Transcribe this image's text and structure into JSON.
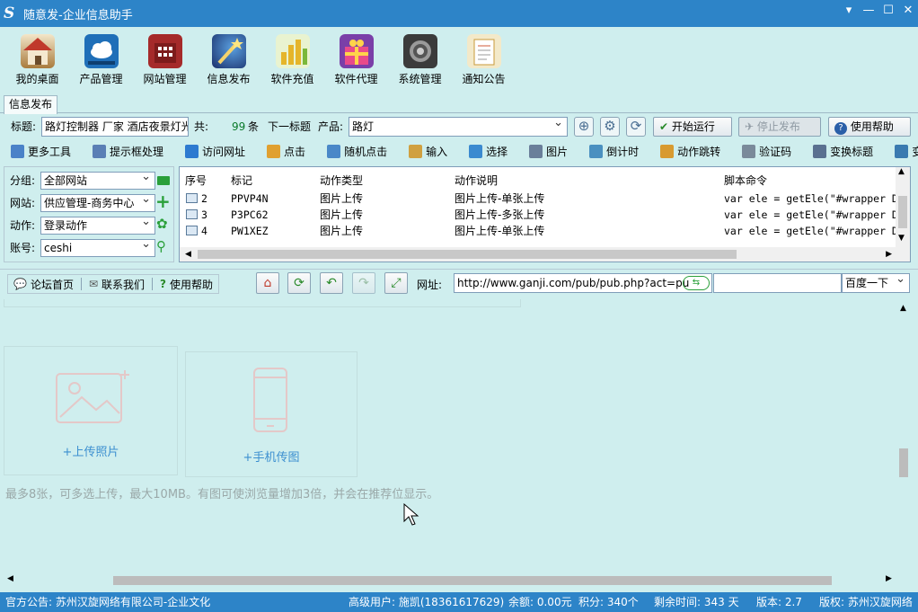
{
  "window": {
    "title": "随意发-企业信息助手",
    "logo_letter": "S"
  },
  "main_toolbar": [
    {
      "label": "我的桌面",
      "icon": "home-icon"
    },
    {
      "label": "产品管理",
      "icon": "cloud-icon"
    },
    {
      "label": "网站管理",
      "icon": "building-icon"
    },
    {
      "label": "信息发布",
      "icon": "wand-icon"
    },
    {
      "label": "软件充值",
      "icon": "coins-icon"
    },
    {
      "label": "软件代理",
      "icon": "gift-icon"
    },
    {
      "label": "系统管理",
      "icon": "gear-icon"
    },
    {
      "label": "通知公告",
      "icon": "notepad-icon"
    }
  ],
  "tab": {
    "label": "信息发布"
  },
  "form": {
    "title_label": "标题:",
    "title_value": "路灯控制器 厂家 酒店夜景灯光",
    "total_label": "共:",
    "total_count": "99",
    "total_unit": "条",
    "next_title_label": "下一标题",
    "product_label": "产品:",
    "product_value": "路灯",
    "start_button": "开始运行",
    "stop_button": "停止发布",
    "help_button": "使用帮助"
  },
  "toolbar2": [
    {
      "label": "更多工具",
      "color": "#4a82c8"
    },
    {
      "label": "提示框处理",
      "color": "#5a7fb5"
    },
    {
      "label": "访问网址",
      "color": "#2d7ad0"
    },
    {
      "label": "点击",
      "color": "#e0a030"
    },
    {
      "label": "随机点击",
      "color": "#4a88c8"
    },
    {
      "label": "输入",
      "color": "#d0a040"
    },
    {
      "label": "选择",
      "color": "#3a8ad0"
    },
    {
      "label": "图片",
      "color": "#6a7f9a"
    },
    {
      "label": "倒计时",
      "color": "#4a90c0"
    },
    {
      "label": "动作跳转",
      "color": "#d89a30"
    },
    {
      "label": "验证码",
      "color": "#7a8a9a"
    },
    {
      "label": "变换标题",
      "color": "#5a7090"
    },
    {
      "label": "变换产品",
      "color": "#3a7ab0"
    }
  ],
  "left_panel": {
    "group_label": "分组:",
    "group_value": "全部网站",
    "site_label": "网站:",
    "site_value": "供应管理-商务中心",
    "action_label": "动作:",
    "action_value": "登录动作",
    "account_label": "账号:",
    "account_value": "ceshi"
  },
  "table": {
    "columns": [
      "序号",
      "标记",
      "动作类型",
      "动作说明",
      "脚本命令"
    ],
    "rows": [
      {
        "no": "2",
        "tag": "PPVP4N",
        "type": "图片上传",
        "desc": "图片上传-单张上传",
        "script": "var ele = getEle(\"#wrapper DIV F"
      },
      {
        "no": "3",
        "tag": "P3PC62",
        "type": "图片上传",
        "desc": "图片上传-多张上传",
        "script": "var ele = getEle(\"#wrapper DIV F"
      },
      {
        "no": "4",
        "tag": "PW1XEZ",
        "type": "图片上传",
        "desc": "图片上传-单张上传",
        "script": "var ele = getEle(\"#wrapper DIV F"
      }
    ]
  },
  "browser_bar": {
    "forum_home": "论坛首页",
    "contact_us": "联系我们",
    "help": "使用帮助",
    "url_label": "网址:",
    "url_value": "http://www.ganji.com/pub/pub.php?act=pu",
    "search_value": "",
    "search_engine": "百度一下"
  },
  "web": {
    "upload_photo": "+上传照片",
    "phone_upload": "+手机传图",
    "hint": "最多8张，可多选上传，最大10MB。有图可使浏览量增加3倍，并会在推荐位显示。"
  },
  "status": {
    "notice": "官方公告: 苏州汉旋网络有限公司-企业文化",
    "user": "高级用户: 施凯(18361617629)",
    "balance": "余额: 0.00元",
    "points": "积分: 340个",
    "remaining": "剩余时间: 343 天",
    "version": "版本: 2.7",
    "copyright": "版权: 苏州汉旋网络"
  },
  "colors": {
    "titlebar": "#2d84c8",
    "background": "#cfeeee",
    "link": "#3b8fd0"
  }
}
